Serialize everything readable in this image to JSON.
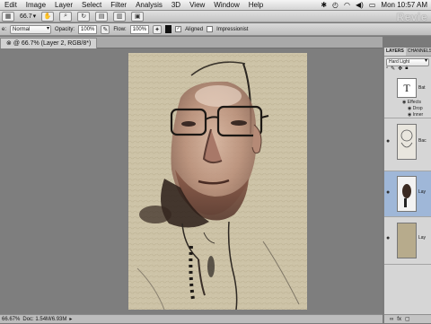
{
  "menubar": {
    "items": [
      "Edit",
      "Image",
      "Layer",
      "Select",
      "Filter",
      "Analysis",
      "3D",
      "View",
      "Window",
      "Help"
    ],
    "clock": "Mon 10:57 AM"
  },
  "appbar": {
    "zoom": "66.7",
    "brand": "Revie"
  },
  "options": {
    "mode_label": "e:",
    "mode_value": "Normal",
    "opacity_label": "Opacity:",
    "opacity_value": "100%",
    "flow_label": "Flow:",
    "flow_value": "100%",
    "aligned_label": "Aligned",
    "impressionist_label": "Impressionist"
  },
  "document": {
    "tab_title": "@ 66.7% (Layer 2, RGB/8*)"
  },
  "status": {
    "zoom": "66.67%",
    "doc_info": "Doc: 1.54M/6.93M"
  },
  "layers_panel": {
    "tab_layers": "LAYERS",
    "tab_channels": "CHANNELS",
    "blend_mode": "Hard Light",
    "layers": [
      {
        "name": "Bat",
        "thumb_text": "T"
      },
      {
        "name": "Bac"
      },
      {
        "name": "Lay"
      },
      {
        "name": "Lay"
      }
    ],
    "effects_label": "Effects",
    "effect_1": "Drop",
    "effect_2": "Inner"
  },
  "colors": {
    "canvas_bg": "#7e7e7e",
    "paper": "#cfc5aa",
    "selected_layer": "#9fb7d8"
  }
}
